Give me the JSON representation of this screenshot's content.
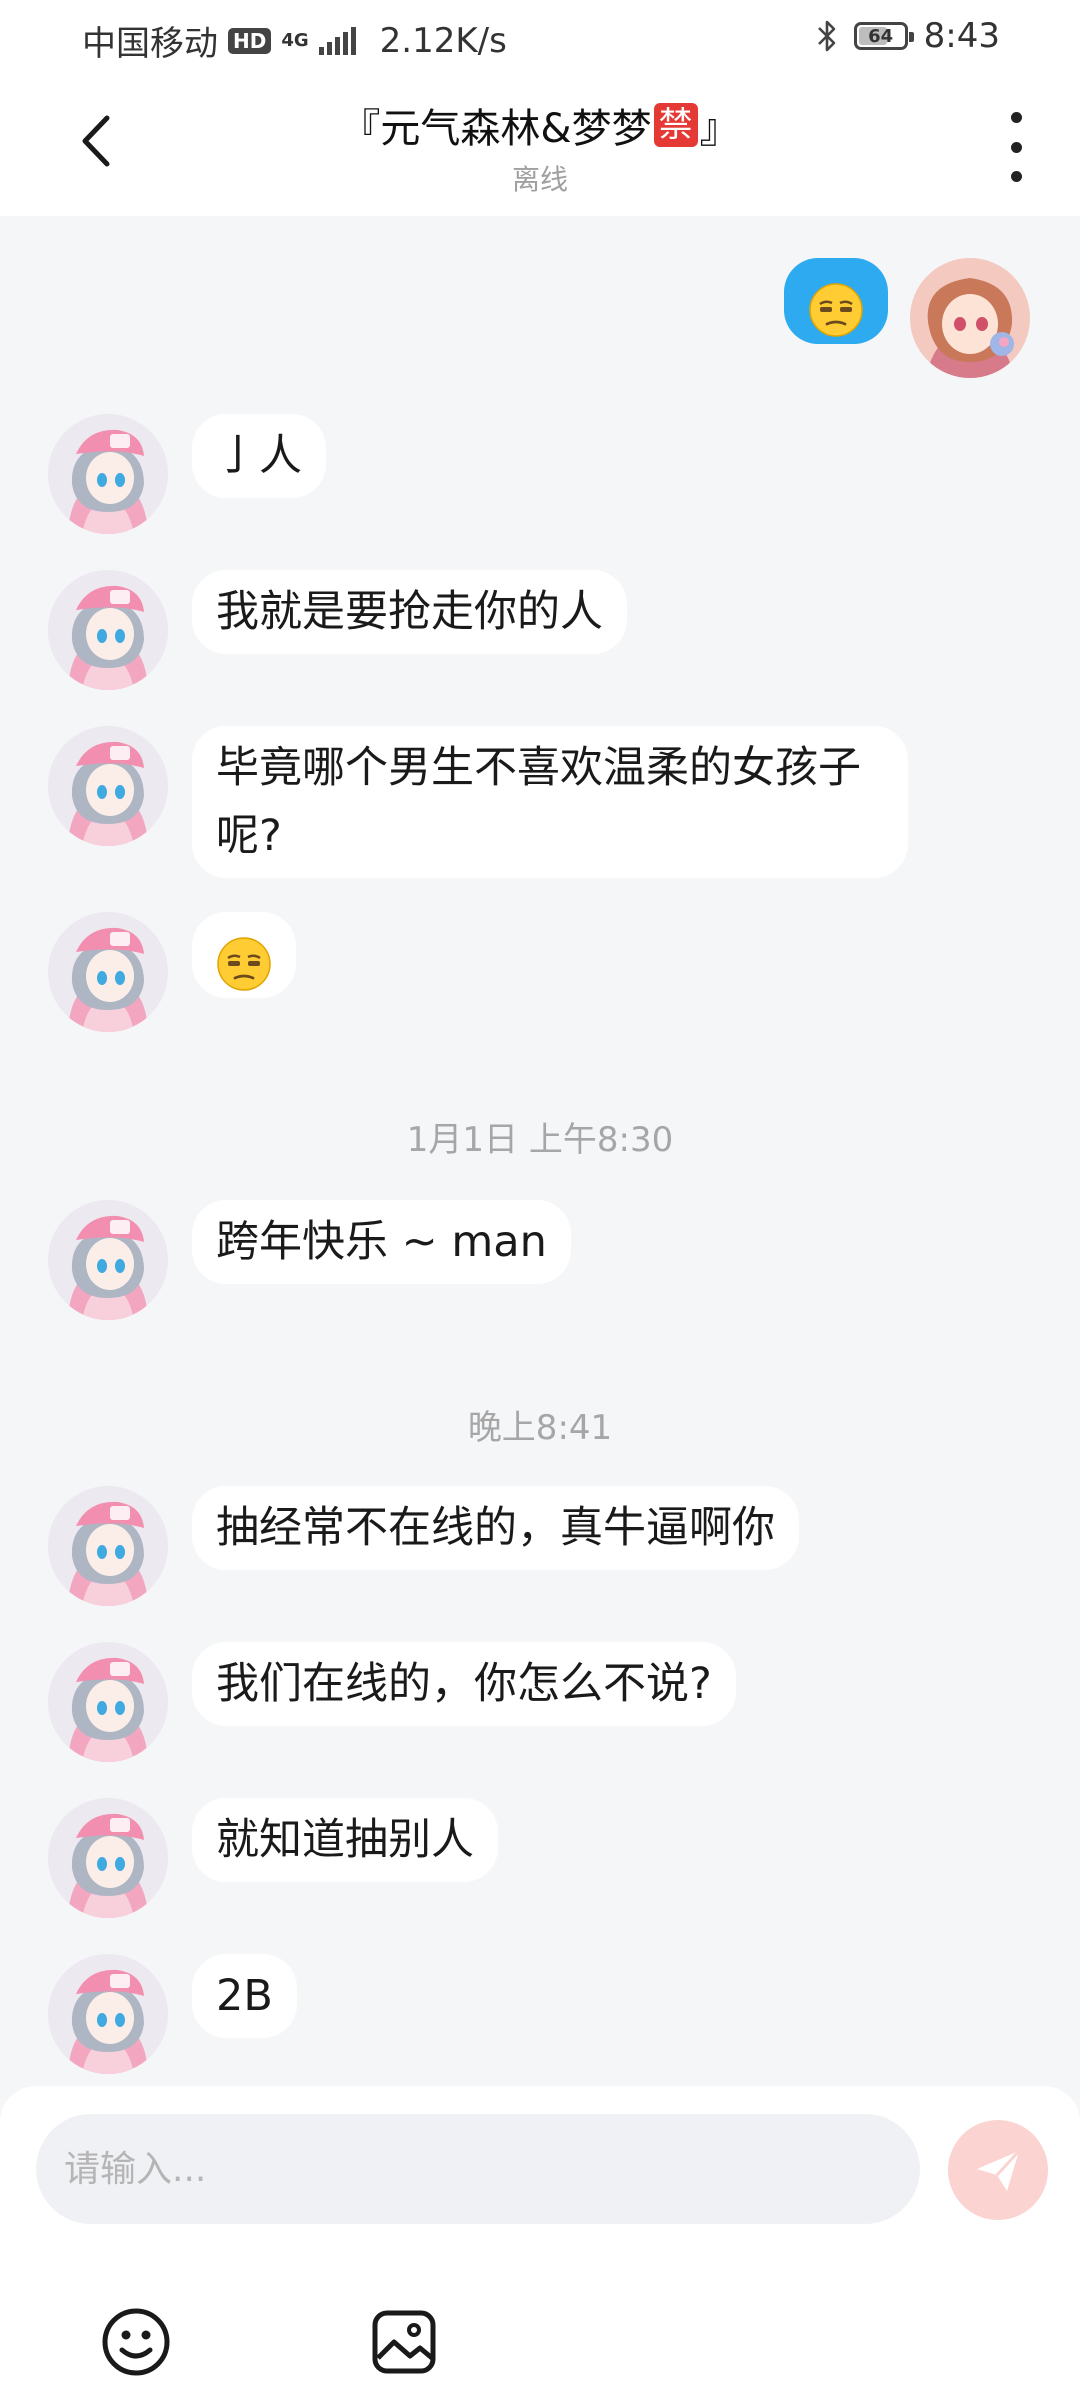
{
  "status_bar": {
    "carrier": "中国移动",
    "hd": "HD",
    "network": "4G",
    "speed": "2.12K/s",
    "battery": "64",
    "battery_level": 0.64,
    "time": "8:43"
  },
  "header": {
    "title_prefix": "『元气森林&梦梦",
    "title_badge": "禁",
    "title_suffix": "』",
    "status": "离线"
  },
  "messages": [
    {
      "sender": "me",
      "text": "",
      "emoji": "unamused-face"
    },
    {
      "sender": "other",
      "text": "亅人"
    },
    {
      "sender": "other",
      "text": "我就是要抢走你的人"
    },
    {
      "sender": "other",
      "text": "毕竟哪个男生不喜欢温柔的女孩子呢?"
    },
    {
      "sender": "other",
      "text": "",
      "emoji": "unamused-face"
    },
    {
      "sender": "other",
      "text": "跨年快乐 ~ man"
    },
    {
      "sender": "other",
      "text": "抽经常不在线的，真牛逼啊你"
    },
    {
      "sender": "other",
      "text": "我们在线的，你怎么不说?"
    },
    {
      "sender": "other",
      "text": "就知道抽别人"
    },
    {
      "sender": "other",
      "text": "2B"
    }
  ],
  "timestamps": [
    "1月1日 上午8:30",
    "晚上8:41"
  ],
  "input": {
    "placeholder": "请输入...",
    "value": ""
  },
  "icons": {
    "back": "chevron-left-icon",
    "more": "more-vertical-icon",
    "send": "paper-plane-icon",
    "emoji": "smiley-icon",
    "image": "image-icon"
  },
  "colors": {
    "my_bubble": "#2daaf0",
    "send_button": "#fbd3d0",
    "ban_badge": "#e53935",
    "background": "#f5f6f8"
  }
}
